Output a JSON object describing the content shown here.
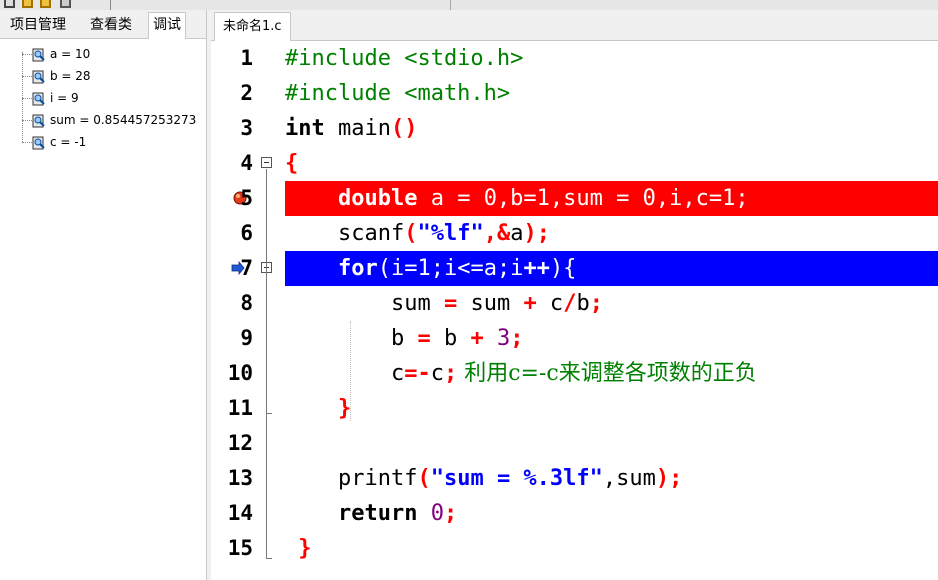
{
  "left_panel": {
    "tabs": [
      "项目管理",
      "查看类",
      "调试"
    ],
    "active_tab": 2,
    "watches": [
      "a = 10",
      "b = 28",
      "i = 9",
      "sum = 0.854457253273",
      "c = -1"
    ]
  },
  "file_tab": {
    "label": "未命名1.c"
  },
  "line_numbers": [
    "1",
    "2",
    "3",
    "4",
    "5",
    "6",
    "7",
    "8",
    "9",
    "10",
    "11",
    "12",
    "13",
    "14",
    "15"
  ],
  "code": {
    "l1_pp": "#include <stdio.h>",
    "l2_pp": "#include <math.h>",
    "l3_kw": "int",
    "l3_rest": " main",
    "l3_paren": "()",
    "l4_brace": "{",
    "l5_indent": "    ",
    "l5_kw": "double",
    "l5_rest": " a = 0,b=1,sum = 0,i,c=1;",
    "l6_indent": "    ",
    "l6_fn": "scanf",
    "l6_p1": "(",
    "l6_str": "\"%lf\"",
    "l6_comma": ",",
    "l6_amp": "&",
    "l6_var": "a",
    "l6_close": ");",
    "l7_indent": "    ",
    "l7_kw": "for",
    "l7_rest": "(i=1;i<=a;i",
    "l7_inc": "++",
    "l7_end": "){",
    "l8_indent": "        ",
    "l8_a": "sum ",
    "l8_eq": "=",
    "l8_b": " sum ",
    "l8_plus": "+",
    "l8_c": " c",
    "l8_div": "/",
    "l8_d": "b",
    "l8_semi": ";",
    "l9_indent": "        ",
    "l9_a": "b ",
    "l9_eq": "=",
    "l9_b": " b ",
    "l9_plus": "+",
    "l9_sp": " ",
    "l9_num": "3",
    "l9_semi": ";",
    "l10_indent": "        ",
    "l10_a": "c",
    "l10_op": "=-",
    "l10_b": "c",
    "l10_semi": ";",
    "l10_comment": " 利用c=-c来调整各项数的正负",
    "l11_indent": "    ",
    "l11_brace": "}",
    "l13_indent": "    ",
    "l13_fn": "printf",
    "l13_p1": "(",
    "l13_str": "\"sum = %.3lf\"",
    "l13_mid": ",sum",
    "l13_close": ");",
    "l14_indent": "    ",
    "l14_kw": "return",
    "l14_sp": " ",
    "l14_num": "0",
    "l14_semi": ";",
    "l15_sp": " ",
    "l15_brace": "}"
  },
  "colors": {
    "breakpoint_line": "#ff0000",
    "current_line": "#0000ff",
    "keyword": "#000000",
    "operator": "#ff0000",
    "number": "#800080",
    "string": "#0000ff",
    "preprocessor": "#008000",
    "comment": "#008000"
  },
  "icons": {
    "watch": "magnifier-icon",
    "breakpoint": "breakpoint-icon",
    "execution": "execution-arrow-icon"
  }
}
